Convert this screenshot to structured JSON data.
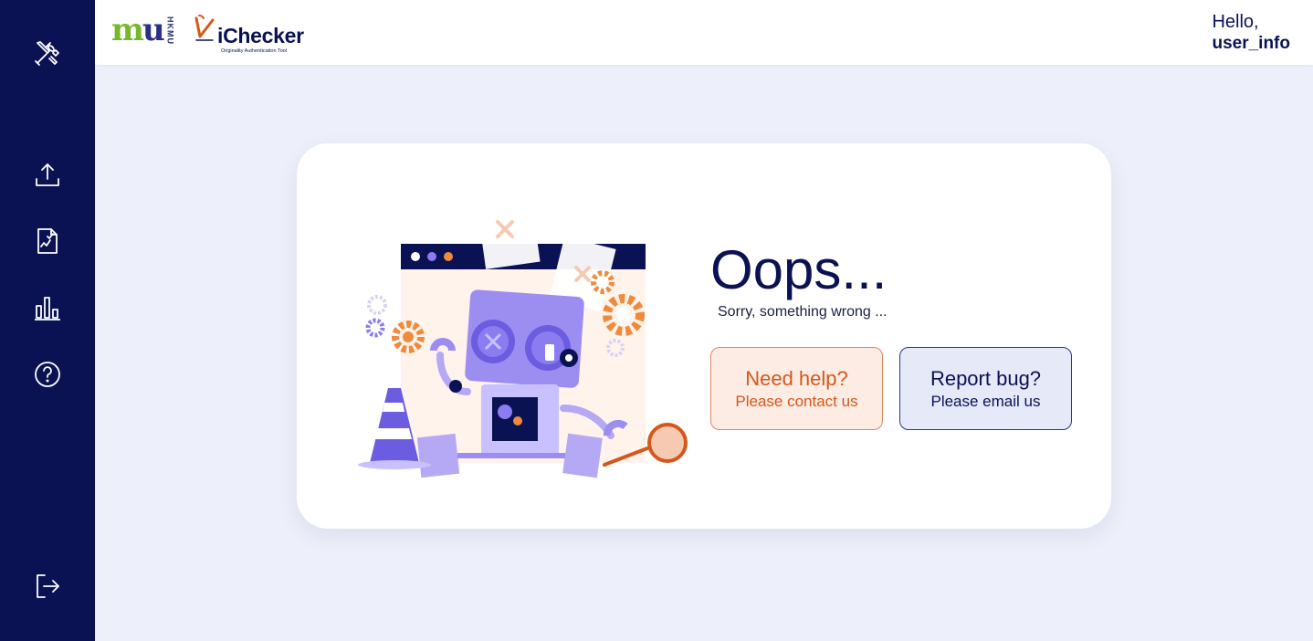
{
  "sidebar": {
    "items": [
      {
        "icon": "tools-icon",
        "name": "tools"
      },
      {
        "icon": "upload-icon",
        "name": "upload"
      },
      {
        "icon": "document-check-icon",
        "name": "reports"
      },
      {
        "icon": "bar-chart-icon",
        "name": "statistics"
      },
      {
        "icon": "help-circle-icon",
        "name": "help"
      },
      {
        "icon": "logout-icon",
        "name": "logout"
      }
    ],
    "background": "#0a1253"
  },
  "header": {
    "logo_primary": "mu",
    "logo_primary_side_text": "HKMU",
    "logo_secondary": "iChecker",
    "logo_secondary_tagline": "Originality Authentication Tool",
    "greeting": "Hello,",
    "username": "user_info"
  },
  "error": {
    "title": "Oops...",
    "message": "Sorry, something wrong ...",
    "help_button": {
      "title": "Need help?",
      "subtitle": "Please contact us"
    },
    "bug_button": {
      "title": "Report bug?",
      "subtitle": "Please email us"
    }
  },
  "colors": {
    "navy": "#0a1253",
    "accent_orange": "#d4571c",
    "page_bg": "#edf0fa",
    "robot_purple": "#9c8ef0"
  }
}
